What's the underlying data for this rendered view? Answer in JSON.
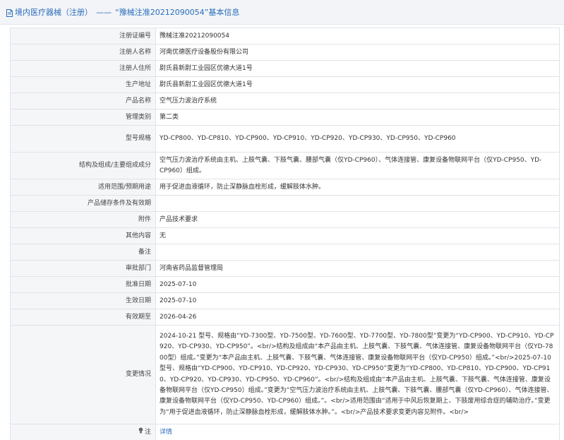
{
  "header": {
    "category": "境内医疗器械（注册）",
    "separator": "——",
    "title": "“豫械注准20212090054”基本信息"
  },
  "rows": [
    {
      "label": "注册证编号",
      "value": "豫械注准20212090054"
    },
    {
      "label": "注册人名称",
      "value": "河南优德医疗设备股份有限公司"
    },
    {
      "label": "注册人住所",
      "value": "尉氏县新尉工业园区优德大道1号"
    },
    {
      "label": "生产地址",
      "value": "尉氏县新尉工业园区优德大道1号"
    },
    {
      "label": "产品名称",
      "value": "空气压力波治疗系统"
    },
    {
      "label": "管理类别",
      "value": "第二类"
    },
    {
      "label": "型号规格",
      "value": "YD-CP800、YD-CP810、YD-CP900、YD-CP910、YD-CP920、YD-CP930、YD-CP950、YD-CP960"
    },
    {
      "label": "结构及组成/主要组成成分",
      "value": "空气压力波治疗系统由主机、上肢气囊、下肢气囊、腰部气囊（仅YD-CP960）、气体连接管、康复设备物联网平台（仅YD-CP950、YD-CP960）组成。"
    },
    {
      "label": "适用范围/预期用途",
      "value": "用于促进血液循环，防止深静脉血栓形成，缓解肢体水肿。"
    },
    {
      "label": "产品储存条件及有效期",
      "value": ""
    },
    {
      "label": "附件",
      "value": "产品技术要求"
    },
    {
      "label": "其他内容",
      "value": "无"
    },
    {
      "label": "备注",
      "value": ""
    },
    {
      "label": "审批部门",
      "value": "河南省药品监督管理局"
    },
    {
      "label": "批准日期",
      "value": "2025-07-10"
    },
    {
      "label": "生效日期",
      "value": "2025-07-10"
    },
    {
      "label": "有效期至",
      "value": "2026-04-26"
    }
  ],
  "change": {
    "label": "变更情况",
    "value": "2024-10-21 型号、规格由“YD-7300型、YD-7500型、YD-7600型、YD-7700型、YD-7800型”变更为“YD-CP900、YD-CP910、YD-CP920、YD-CP930、YD-CP950”。<br/>结构及组成由“本产品由主机、上肢气囊、下肢气囊、气体连接管、康复设备物联网平台（仅YD-7800型）组成。”变更为“本产品由主机、上肢气囊、下肢气囊、气体连接管、康复设备物联网平台（仅YD-CP950）组成。”<br/>2025-07-10型号、规格由“YD-CP900、YD-CP910、YD-CP920、YD-CP930、YD-CP950”变更为“YD-CP800、YD-CP810、YD-CP900、YD-CP910、YD-CP920、YD-CP930、YD-CP950、YD-CP960”。<br/>结构及组成由“本产品由主机、上肢气囊、下肢气囊、气体连接管、康复设备物联网平台（仅YD-CP950）组成。”变更为“空气压力波治疗系统由主机、上肢气囊、下肢气囊、腰部气囊（仅YD-CP960）、气体连接管、康复设备物联网平台（仅YD-CP950、YD-CP960）组成。”。<br/>适用范围由“适用于中风后恢复期上、下肢废用综合症的辅助治疗。”变更为“用于促进血液循环，防止深静脉血栓形成，缓解肢体水肿。”。<br/>产品技术要求变更内容见附件。<br/>"
  },
  "note_row": {
    "icon": "bulb-icon",
    "label": "注",
    "link": "详情"
  },
  "colors": {
    "accent": "#2a6ebb",
    "label_bg": "#f5f6f8",
    "border": "#dfe3e8",
    "header_bg": "#f2f4f7"
  }
}
